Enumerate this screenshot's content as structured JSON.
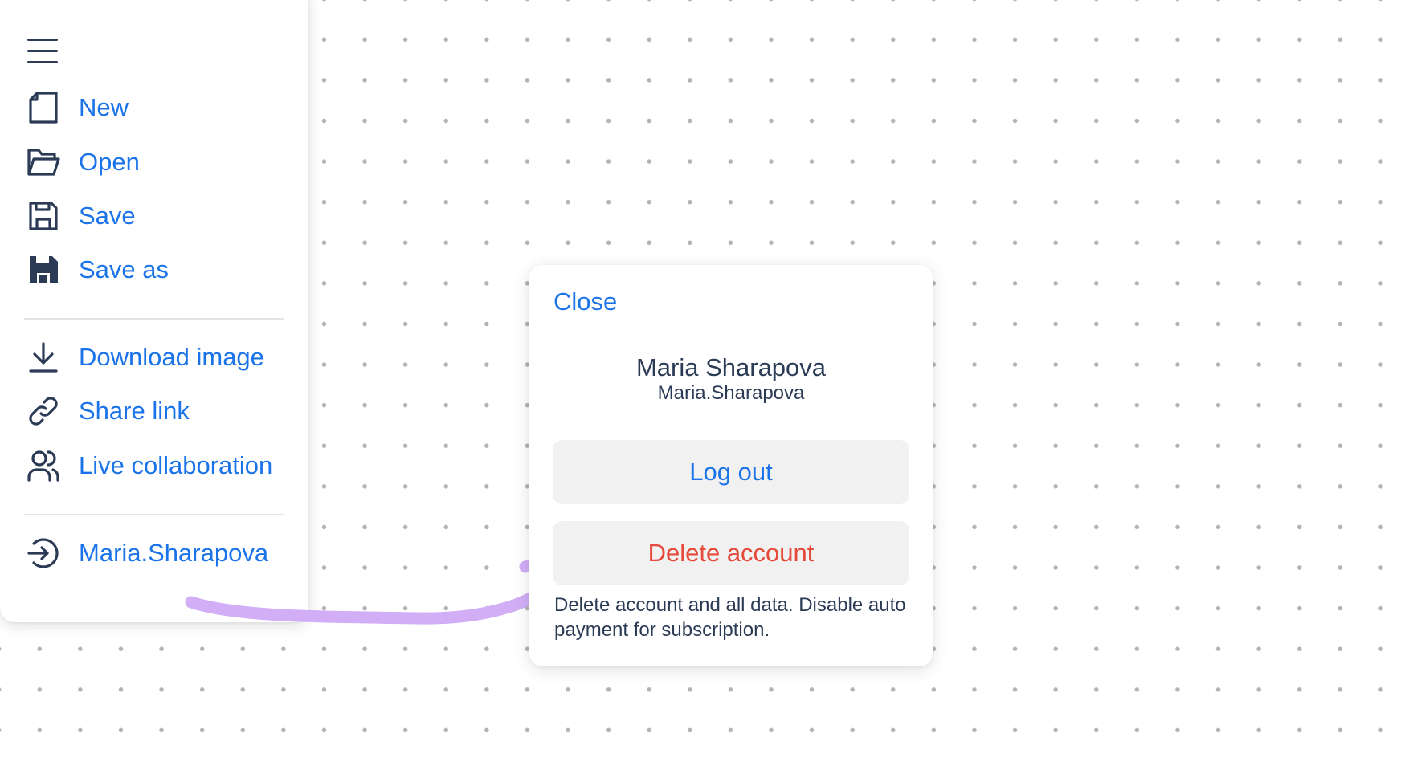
{
  "menu": {
    "items": [
      {
        "label": "New",
        "icon": "new-file-icon"
      },
      {
        "label": "Open",
        "icon": "folder-open-icon"
      },
      {
        "label": "Save",
        "icon": "save-icon"
      },
      {
        "label": "Save as",
        "icon": "save-as-icon"
      },
      {
        "label": "Download image",
        "icon": "download-icon"
      },
      {
        "label": "Share link",
        "icon": "link-icon"
      },
      {
        "label": "Live collaboration",
        "icon": "users-icon"
      },
      {
        "label": "Maria.Sharapova",
        "icon": "sign-in-icon"
      }
    ]
  },
  "dialog": {
    "close_label": "Close",
    "user_name": "Maria Sharapova",
    "user_login": "Maria.Sharapova",
    "logout_label": "Log out",
    "delete_label": "Delete account",
    "delete_description": "Delete account and all data. Disable auto payment for subscription."
  },
  "colors": {
    "link": "#1a73e8",
    "danger": "#e5493a",
    "text": "#2b3a55",
    "arrow": "#d2aef7",
    "button_bg": "#f1f1f1"
  }
}
